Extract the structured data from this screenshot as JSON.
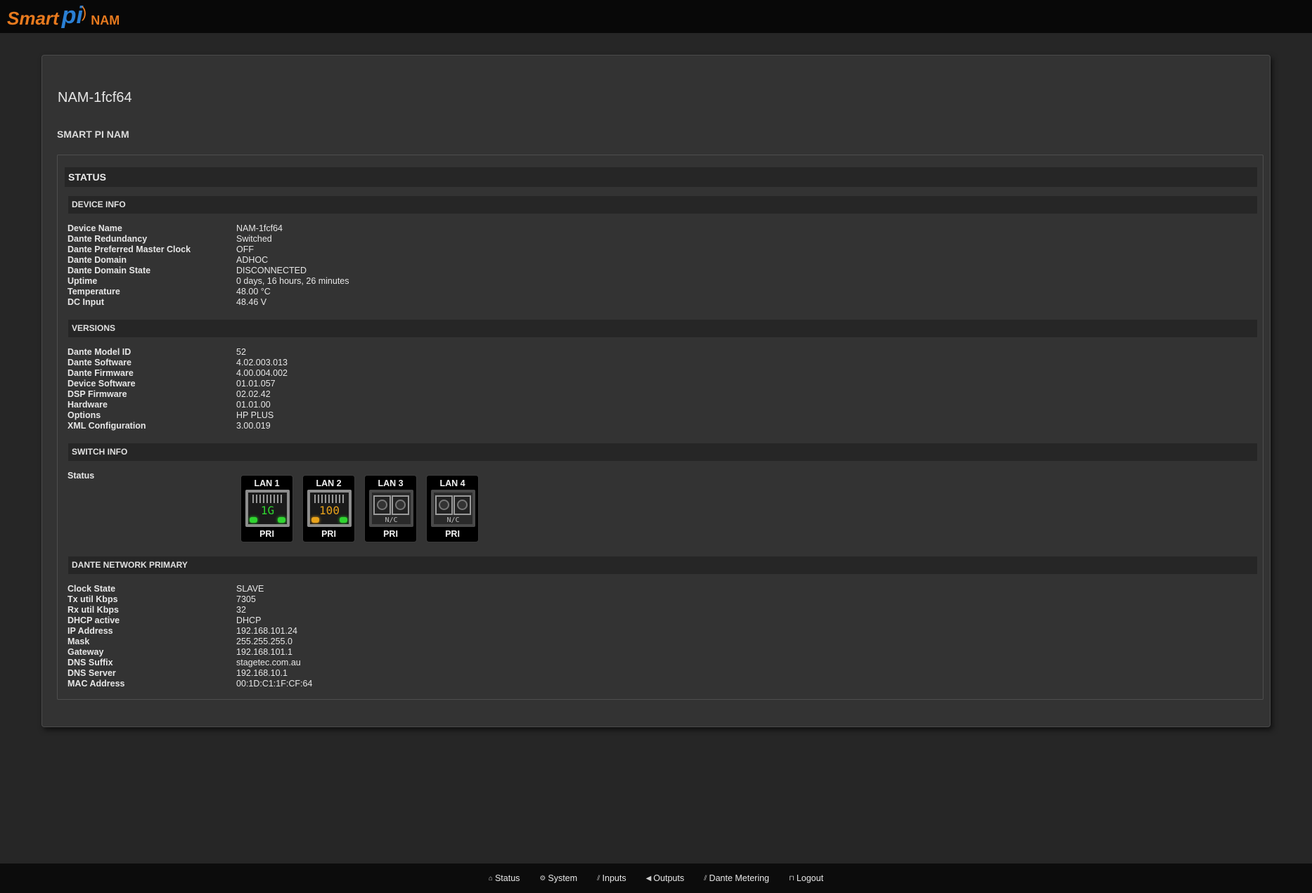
{
  "logo": {
    "smart": "Smart",
    "pi": "pi",
    "nam": "NAM"
  },
  "page": {
    "title": "NAM-1fcf64",
    "subtitle": "SMART PI NAM"
  },
  "status_header": "STATUS",
  "sections": {
    "device_info": {
      "title": "DEVICE INFO",
      "rows": [
        {
          "key": "Device Name",
          "value": "NAM-1fcf64"
        },
        {
          "key": "Dante Redundancy",
          "value": "Switched"
        },
        {
          "key": "Dante Preferred Master Clock",
          "value": "OFF"
        },
        {
          "key": "Dante Domain",
          "value": "ADHOC"
        },
        {
          "key": "Dante Domain State",
          "value": "DISCONNECTED"
        },
        {
          "key": "Uptime",
          "value": "0 days, 16 hours, 26 minutes"
        },
        {
          "key": "Temperature",
          "value": "48.00 °C"
        },
        {
          "key": "DC Input",
          "value": "48.46 V"
        }
      ]
    },
    "versions": {
      "title": "VERSIONS",
      "rows": [
        {
          "key": "Dante Model ID",
          "value": "52"
        },
        {
          "key": "Dante Software",
          "value": "4.02.003.013"
        },
        {
          "key": "Dante Firmware",
          "value": "4.00.004.002"
        },
        {
          "key": "Device Software",
          "value": "01.01.057"
        },
        {
          "key": "DSP Firmware",
          "value": "02.02.42"
        },
        {
          "key": "Hardware",
          "value": "01.01.00"
        },
        {
          "key": "Options",
          "value": "HP PLUS"
        },
        {
          "key": "XML Configuration",
          "value": "3.00.019"
        }
      ]
    },
    "switch_info": {
      "title": "SWITCH INFO",
      "status_label": "Status",
      "ports": [
        {
          "name": "LAN 1",
          "speed": "1G",
          "role": "PRI",
          "state": "connected",
          "speed_color": "#2fd42f"
        },
        {
          "name": "LAN 2",
          "speed": "100",
          "role": "PRI",
          "state": "connected",
          "speed_color": "#e8a21a"
        },
        {
          "name": "LAN 3",
          "speed": "N/C",
          "role": "PRI",
          "state": "nc"
        },
        {
          "name": "LAN 4",
          "speed": "N/C",
          "role": "PRI",
          "state": "nc"
        }
      ]
    },
    "dante_primary": {
      "title": "DANTE NETWORK PRIMARY",
      "rows": [
        {
          "key": "Clock State",
          "value": "SLAVE"
        },
        {
          "key": "Tx util Kbps",
          "value": "7305"
        },
        {
          "key": "Rx util Kbps",
          "value": "32"
        },
        {
          "key": "DHCP active",
          "value": "DHCP"
        },
        {
          "key": "IP Address",
          "value": "192.168.101.24"
        },
        {
          "key": "Mask",
          "value": "255.255.255.0"
        },
        {
          "key": "Gateway",
          "value": "192.168.101.1"
        },
        {
          "key": "DNS Suffix",
          "value": "stagetec.com.au"
        },
        {
          "key": "DNS Server",
          "value": "192.168.10.1"
        },
        {
          "key": "MAC Address",
          "value": "00:1D:C1:1F:CF:64"
        }
      ]
    }
  },
  "nav": [
    {
      "label": "Status",
      "icon": "home-icon",
      "glyph": "⌂"
    },
    {
      "label": "System",
      "icon": "gear-icon",
      "glyph": "⚙"
    },
    {
      "label": "Inputs",
      "icon": "signal-icon",
      "glyph": "⫽"
    },
    {
      "label": "Outputs",
      "icon": "speaker-icon",
      "glyph": "◀"
    },
    {
      "label": "Dante Metering",
      "icon": "signal-icon",
      "glyph": "⫽"
    },
    {
      "label": "Logout",
      "icon": "lock-icon",
      "glyph": "⊓"
    }
  ],
  "colors": {
    "background": "#262626",
    "panel": "#333333",
    "bar": "#080808",
    "accent_orange": "#e87a1e",
    "accent_blue": "#2a7fd4",
    "led_green": "#2fd42f",
    "led_orange": "#e8a21a"
  }
}
